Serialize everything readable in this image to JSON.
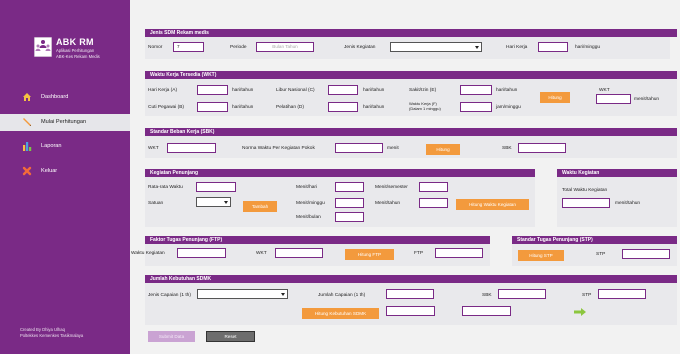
{
  "app": {
    "title": "ABK RM",
    "subtitle1": "Aplikasi Perhitungan",
    "subtitle2": "ABK-Kes Rekam Medis"
  },
  "sidebar": {
    "items": [
      {
        "label": "Dashboard",
        "icon": "house-icon",
        "active": false
      },
      {
        "label": "Mulai Perhitungan",
        "icon": "pencil-icon",
        "active": true
      },
      {
        "label": "Laporan",
        "icon": "bar-chart-icon",
        "active": false
      },
      {
        "label": "Keluar",
        "icon": "close-icon",
        "active": false
      }
    ],
    "footer1": "Created By Dhiya Ulhaq",
    "footer2": "Poltekkes Kemenkes Tasikmalaya"
  },
  "jenis_sdm": {
    "title": "Jenis SDM Rekam medis",
    "nomor_label": "Nomor",
    "nomor_value": "7",
    "periode_label": "Periode",
    "periode_placeholder": "Bulan Tahun",
    "jenis_kegiatan_label": "Jenis Kegiatan",
    "hari_kerja_label": "Hari Kerja",
    "hari_kerja_unit": "hari/minggu"
  },
  "wkt": {
    "title": "Waktu Kerja Tersedia (WKT)",
    "hari_kerja_label": "Hari Kerja (A)",
    "cuti_label": "Cuti Pegawai (B)",
    "libur_label": "Libur Nasional (C)",
    "pelatihan_label": "Pelatihan (D)",
    "sakit_label": "Sakit/Izin (E)",
    "waktu_kerja_label": "Waktu Kerja (F)",
    "waktu_kerja_sub": "(Dalam 1 minggu)",
    "unit_hari_tahun": "hari/tahun",
    "unit_jam_minggu": "jam/minggu",
    "hitung_label": "Hitung",
    "wkt_label": "WKT",
    "wkt_unit": "menit/tahun"
  },
  "sbk": {
    "title": "Standar Beban Kerja (SBK)",
    "wkt_label": "WKT",
    "norma_label": "Norma Waktu Per Kegiatan Pokok",
    "norma_unit": "menit",
    "hitung_label": "Hitung",
    "sbk_label": "SBK"
  },
  "penunjang": {
    "title": "Kegiatan Penunjang",
    "rata_label": "Rata-rata Waktu",
    "satuan_label": "Satuan",
    "tambah_label": "Tambah",
    "menit_hari": "Menit/hari",
    "menit_minggu": "Menit/minggu",
    "menit_bulan": "Menit/bulan",
    "menit_semester": "Menit/semester",
    "menit_tahun": "Menit/tahun",
    "hitung_total_label": "Hitung Waktu Kegiatan"
  },
  "waktu_kegiatan": {
    "title": "Waktu Kegiatan",
    "total_label": "Total Waktu Kegiatan",
    "unit": "menit/tahun"
  },
  "ftp": {
    "title": "Faktor Tugas Penunjang (FTP)",
    "waktu_label": "Waktu Kegiatan",
    "wkt_label": "WKT",
    "hitung_label": "Hitung FTP",
    "ftp_label": "FTP"
  },
  "stp": {
    "title": "Standar Tugas Penunjang (STP)",
    "hitung_label": "Hitung STP",
    "stp_label": "STP"
  },
  "sdmk": {
    "title": "Jumlah Kebutuhan SDMK",
    "jenis_label": "Jenis Capaian (1 th)",
    "jumlah_label": "Jumlah Capaian (1 th)",
    "sbk_label": "SBK",
    "stp_label": "STP",
    "hitung_label": "Hitung Kebutuhan SDMK"
  },
  "actions": {
    "submit_label": "Submit Data",
    "reset_label": "Reset"
  },
  "colors": {
    "primary": "#7a2a86",
    "accent": "#f39a3d",
    "panel": "#e9e9ec"
  }
}
